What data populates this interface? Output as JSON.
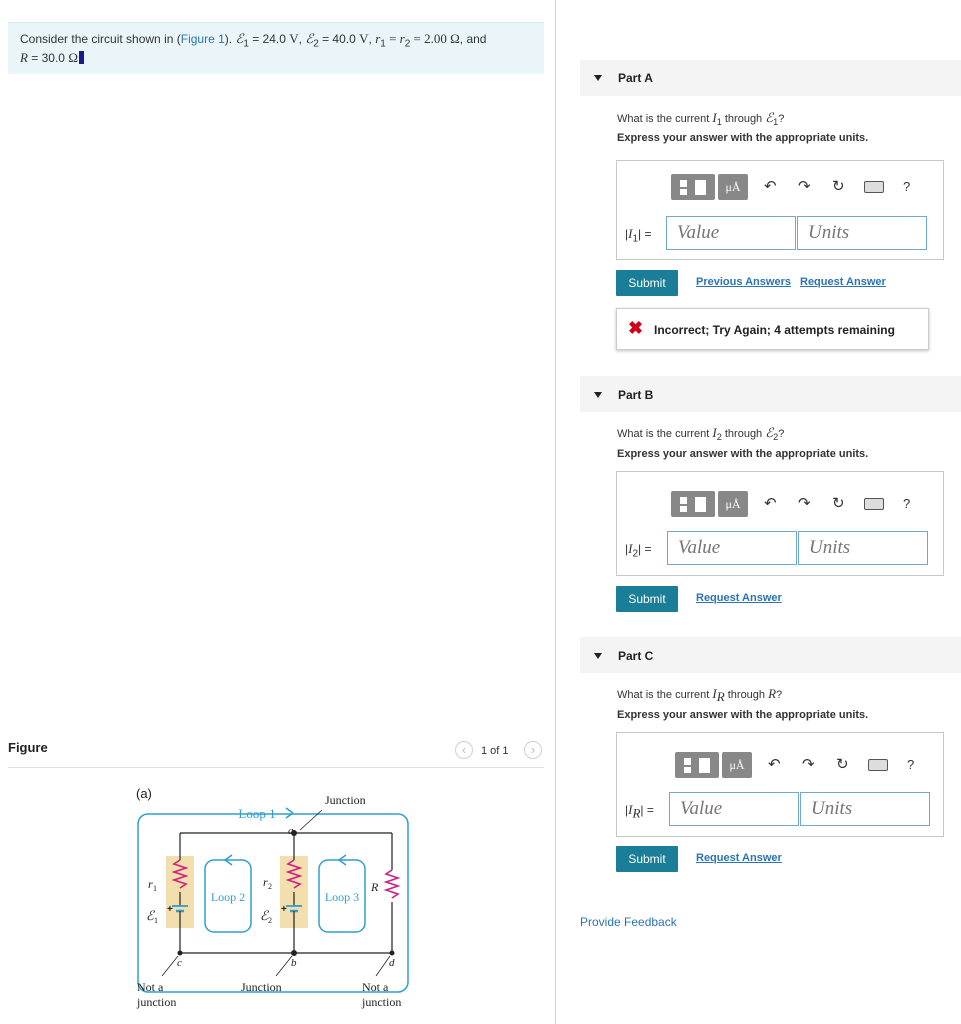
{
  "problem": {
    "p1": "Consider the circuit shown in (",
    "figure_link": "Figure 1",
    "p2": "). ",
    "e1": "ℰ",
    "e1_sub": "1",
    "e1_val": " = 24.0 ",
    "e1_unit": "V",
    "sep": ", ",
    "e2": "ℰ",
    "e2_sub": "2",
    "e2_val": " = 40.0 ",
    "e2_unit": "V",
    "r1": "r",
    "r1_sub": "1",
    "eq": " = ",
    "r2": "r",
    "r2_sub": "2",
    "r_val": " = 2.00 Ω",
    "and": ", and",
    "R": "R",
    "R_val": " = 30.0 ",
    "R_unit": "Ω"
  },
  "figure": {
    "label": "Figure",
    "pager": "1 of 1",
    "prev": "‹",
    "next": "›",
    "panel": "(a)",
    "loop1": "Loop 1",
    "loop2": "Loop 2",
    "loop3": "Loop 3",
    "junction": "Junction",
    "junction_bottom": "Junction",
    "not_junction_left_1": "Not a",
    "not_junction_left_2": "junction",
    "not_junction_right_1": "Not a",
    "not_junction_right_2": "junction",
    "node_a": "a",
    "node_b": "b",
    "node_c": "c",
    "node_d": "d",
    "r1": "r",
    "r1_sub": "1",
    "r2": "r",
    "r2_sub": "2",
    "e1": "ℰ",
    "e1_sub": "1",
    "e2": "ℰ",
    "e2_sub": "2",
    "R": "R",
    "plus": "+"
  },
  "toolbar": {
    "mu": "μÅ",
    "undo": "↶",
    "redo": "↷",
    "reset": "↻",
    "help": "?",
    "icons": [
      "template-icon",
      "undo-icon",
      "redo-icon",
      "reset-icon",
      "keyboard-icon",
      "help-icon"
    ]
  },
  "parts": [
    {
      "title": "Part A",
      "q_pre": "What is the current ",
      "q_var": "I",
      "q_var_sub": "1",
      "q_mid": " through ",
      "q_src": "ℰ",
      "q_src_sub": "1",
      "q_post": "?",
      "instruction": "Express your answer with the appropriate units.",
      "var_label_pre": "|",
      "var_label_var": "I",
      "var_label_sub": "1",
      "var_label_post": "| =",
      "value_placeholder": "Value",
      "units_placeholder": "Units",
      "submit": "Submit",
      "prev_answers": "Previous Answers",
      "request_answer": "Request Answer",
      "feedback_icon": "✖",
      "feedback": "Incorrect; Try Again; 4 attempts remaining"
    },
    {
      "title": "Part B",
      "q_pre": "What is the current ",
      "q_var": "I",
      "q_var_sub": "2",
      "q_mid": " through ",
      "q_src": "ℰ",
      "q_src_sub": "2",
      "q_post": "?",
      "instruction": "Express your answer with the appropriate units.",
      "var_label_pre": "|",
      "var_label_var": "I",
      "var_label_sub": "2",
      "var_label_post": "| =",
      "value_placeholder": "Value",
      "units_placeholder": "Units",
      "submit": "Submit",
      "request_answer": "Request Answer"
    },
    {
      "title": "Part C",
      "q_pre": "What is the current ",
      "q_var": "I",
      "q_var_sub": "R",
      "q_mid": " through ",
      "q_src": "R",
      "q_post": "?",
      "instruction": "Express your answer with the appropriate units.",
      "var_label_pre": "|",
      "var_label_var": "I",
      "var_label_sub": "R",
      "var_label_post": "| =",
      "value_placeholder": "Value",
      "units_placeholder": "Units",
      "submit": "Submit",
      "request_answer": "Request Answer"
    }
  ],
  "provide_feedback": "Provide Feedback",
  "colors": {
    "accent": "#1a7e99",
    "link": "#2a73b7",
    "problem_bg": "#e9f5f8",
    "error": "#d0021b",
    "loop": "#2f9fd0",
    "resistor": "#d0207e",
    "battery_bg": "#f3dfae"
  }
}
